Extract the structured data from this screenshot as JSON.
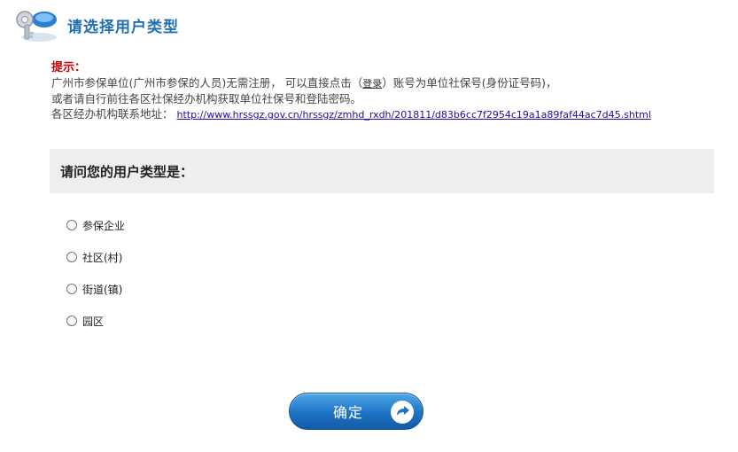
{
  "header": {
    "title": "请选择用户类型"
  },
  "tip": {
    "label": "提示：",
    "line1_before": "广州市参保单位(广州市参保的人员)无需注册， 可以直接点击（",
    "login_link": "登录",
    "line1_after": "）账号为单位社保号(身份证号码)，",
    "line2": "或者请自行前往各区社保经办机构获取单位社保号和登陆密码。",
    "line3_label": "各区经办机构联系地址：",
    "url": "http://www.hrssgz.gov.cn/hrssgz/zmhd_rxdh/201811/d83b6cc7f2954c19a1a89faf44ac7d45.shtml"
  },
  "question": {
    "text": "请问您的用户类型是："
  },
  "options": [
    {
      "label": "参保企业"
    },
    {
      "label": "社区(村)"
    },
    {
      "label": "街道(镇)"
    },
    {
      "label": "园区"
    }
  ],
  "confirm": {
    "label": "确定"
  },
  "colors": {
    "title": "#1f6fb2",
    "tip_label": "#cc0000",
    "button": "#1f73c4"
  }
}
